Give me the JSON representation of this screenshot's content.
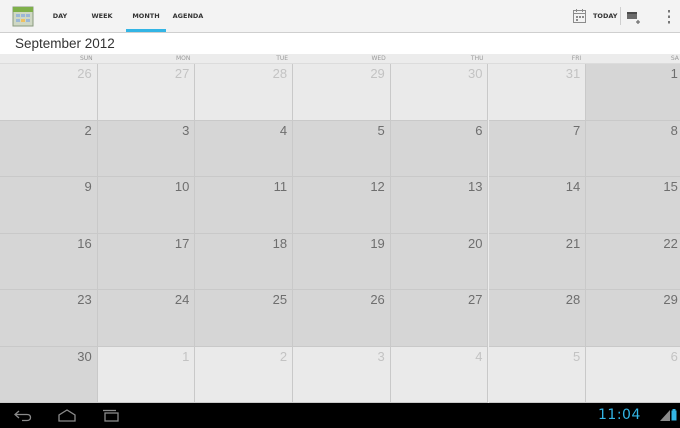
{
  "action_bar": {
    "tabs": [
      {
        "label": "DAY",
        "active": false
      },
      {
        "label": "WEEK",
        "active": false
      },
      {
        "label": "MONTH",
        "active": true
      },
      {
        "label": "AGENDA",
        "active": false
      }
    ],
    "today_label": "TODAY",
    "icons": [
      "calendar-app-icon",
      "today-calendar-icon",
      "new-event-icon",
      "overflow-menu-icon"
    ]
  },
  "month_title": "September 2012",
  "weekdays": [
    "SUN",
    "MON",
    "TUE",
    "WED",
    "THU",
    "FRI",
    "SA"
  ],
  "weeks": [
    [
      {
        "day": "26",
        "in_month": false
      },
      {
        "day": "27",
        "in_month": false
      },
      {
        "day": "28",
        "in_month": false
      },
      {
        "day": "29",
        "in_month": false
      },
      {
        "day": "30",
        "in_month": false
      },
      {
        "day": "31",
        "in_month": false
      },
      {
        "day": "1",
        "in_month": true
      }
    ],
    [
      {
        "day": "2",
        "in_month": true
      },
      {
        "day": "3",
        "in_month": true
      },
      {
        "day": "4",
        "in_month": true
      },
      {
        "day": "5",
        "in_month": true
      },
      {
        "day": "6",
        "in_month": true
      },
      {
        "day": "7",
        "in_month": true
      },
      {
        "day": "8",
        "in_month": true
      }
    ],
    [
      {
        "day": "9",
        "in_month": true
      },
      {
        "day": "10",
        "in_month": true
      },
      {
        "day": "11",
        "in_month": true
      },
      {
        "day": "12",
        "in_month": true
      },
      {
        "day": "13",
        "in_month": true
      },
      {
        "day": "14",
        "in_month": true
      },
      {
        "day": "15",
        "in_month": true
      }
    ],
    [
      {
        "day": "16",
        "in_month": true
      },
      {
        "day": "17",
        "in_month": true
      },
      {
        "day": "18",
        "in_month": true
      },
      {
        "day": "19",
        "in_month": true
      },
      {
        "day": "20",
        "in_month": true
      },
      {
        "day": "21",
        "in_month": true
      },
      {
        "day": "22",
        "in_month": true
      }
    ],
    [
      {
        "day": "23",
        "in_month": true
      },
      {
        "day": "24",
        "in_month": true
      },
      {
        "day": "25",
        "in_month": true
      },
      {
        "day": "26",
        "in_month": true
      },
      {
        "day": "27",
        "in_month": true
      },
      {
        "day": "28",
        "in_month": true
      },
      {
        "day": "29",
        "in_month": true
      }
    ],
    [
      {
        "day": "30",
        "in_month": true
      },
      {
        "day": "1",
        "in_month": false
      },
      {
        "day": "2",
        "in_month": false
      },
      {
        "day": "3",
        "in_month": false
      },
      {
        "day": "4",
        "in_month": false
      },
      {
        "day": "5",
        "in_month": false
      },
      {
        "day": "6",
        "in_month": false
      }
    ]
  ],
  "system_bar": {
    "time": "11:04",
    "icons": [
      "back-icon",
      "home-icon",
      "recent-apps-icon",
      "signal-icon",
      "battery-icon"
    ]
  },
  "colors": {
    "accent": "#33b5e5",
    "in_month_cell": "#d6d6d6",
    "out_month_cell": "#eaeaea"
  }
}
